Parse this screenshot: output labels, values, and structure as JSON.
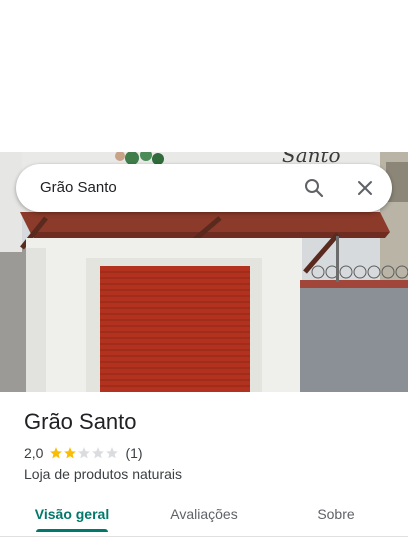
{
  "search": {
    "query": "Grão Santo"
  },
  "photo": {
    "sign_text": "Santo"
  },
  "place": {
    "name": "Grão Santo",
    "rating": "2,0",
    "stars_filled": 2,
    "stars_total": 5,
    "review_count": "(1)",
    "category": "Loja de produtos naturais"
  },
  "tabs": [
    {
      "label": "Visão geral",
      "active": true
    },
    {
      "label": "Avaliações",
      "active": false
    },
    {
      "label": "Sobre",
      "active": false
    }
  ],
  "colors": {
    "accent": "#00796b",
    "star_filled": "#fbbc04",
    "star_empty": "#dadce0",
    "shutter": "#b3321f"
  },
  "icons": {
    "search": "search-icon",
    "close": "close-icon",
    "star": "star-icon"
  }
}
